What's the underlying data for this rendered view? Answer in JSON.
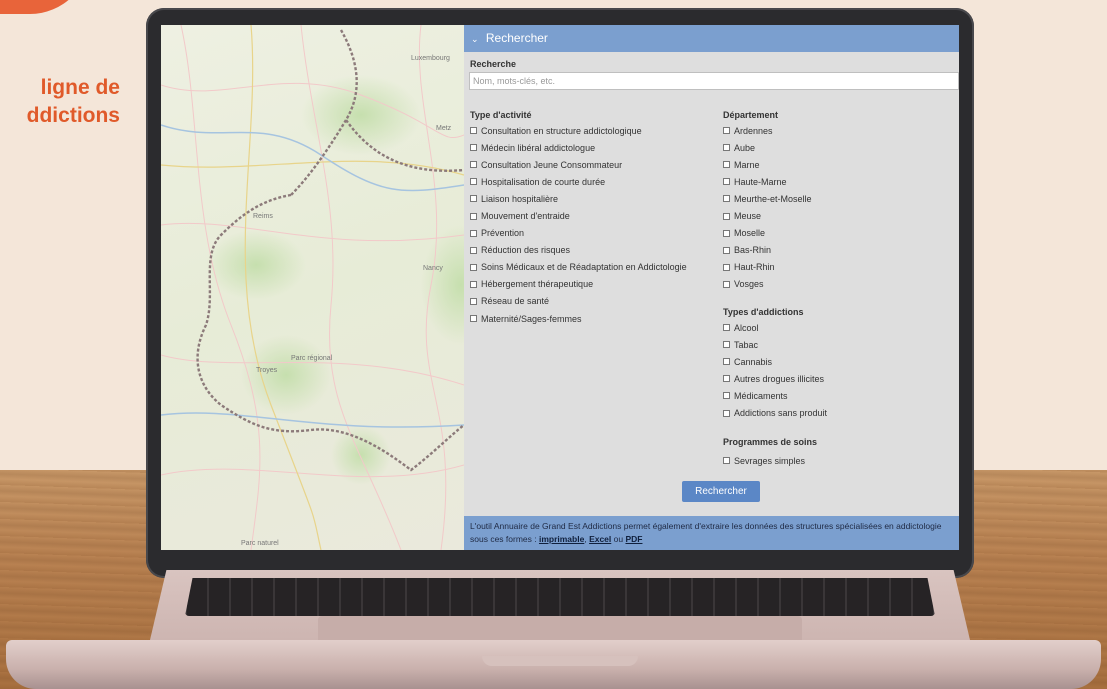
{
  "headline": {
    "line1": "ligne de",
    "line2": "ddictions"
  },
  "map": {
    "labels": [
      "Reims",
      "Nancy",
      "Troyes",
      "Parc naturel",
      "Luxembourg",
      "Parc régional",
      "Metz"
    ]
  },
  "panel": {
    "header": {
      "icon": "chevron-down-icon",
      "title": "Rechercher"
    },
    "search": {
      "label": "Recherche",
      "placeholder": "Nom, mots-clés, etc.",
      "value": ""
    },
    "activity": {
      "title": "Type d'activité",
      "items": [
        "Consultation en structure addictologique",
        "Médecin libéral addictologue",
        "Consultation Jeune Consommateur",
        "Hospitalisation de courte durée",
        "Liaison hospitalière",
        "Mouvement d'entraide",
        "Prévention",
        "Réduction des risques",
        "Soins Médicaux et de Réadaptation en Addictologie",
        "Hébergement thérapeutique",
        "Réseau de santé",
        "Maternité/Sages-femmes"
      ]
    },
    "department": {
      "title": "Département",
      "items": [
        "Ardennes",
        "Aube",
        "Marne",
        "Haute-Marne",
        "Meurthe-et-Moselle",
        "Meuse",
        "Moselle",
        "Bas-Rhin",
        "Haut-Rhin",
        "Vosges"
      ]
    },
    "addictions": {
      "title": "Types d'addictions",
      "items": [
        "Alcool",
        "Tabac",
        "Cannabis",
        "Autres drogues illicites",
        "Médicaments",
        "Addictions sans produit"
      ]
    },
    "programs": {
      "title": "Programmes de soins",
      "items": [
        "Sevrages simples"
      ]
    },
    "submit_label": "Rechercher",
    "footer": {
      "text": "L'outil Annuaire de Grand Est Addictions permet également d'extraire les données des structures spécialisées en addictologie sous ces formes : ",
      "link_print": "imprimable",
      "sep1": ", ",
      "link_excel": "Excel",
      "sep2": " ou ",
      "link_pdf": "PDF"
    }
  },
  "colors": {
    "header_blue": "#7b9fcf",
    "button_blue": "#5b87c6",
    "accent_orange": "#e05a2a"
  }
}
